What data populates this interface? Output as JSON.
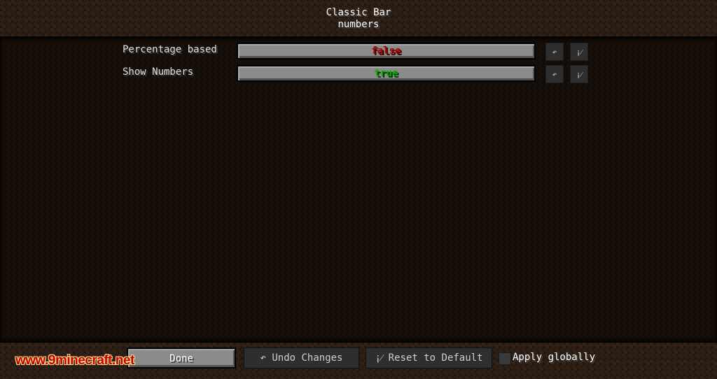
{
  "header": {
    "title_line1": "Classic Bar",
    "title_line2": "numbers"
  },
  "options": [
    {
      "label": "Percentage based",
      "value": "false",
      "undo_icon": "↶",
      "reset_icon": "¡⁄"
    },
    {
      "label": "Show Numbers",
      "value": "true",
      "undo_icon": "↶",
      "reset_icon": "¡⁄"
    }
  ],
  "footer": {
    "done_label": "Done",
    "undo_label": "↶ Undo Changes",
    "reset_label": "¡⁄ Reset to Default",
    "apply_globally_label": "Apply globally",
    "apply_globally_checked": false
  },
  "watermark": "www.9minecraft.net",
  "colors": {
    "false_value": "#aa0000",
    "true_value": "#00aa00"
  }
}
